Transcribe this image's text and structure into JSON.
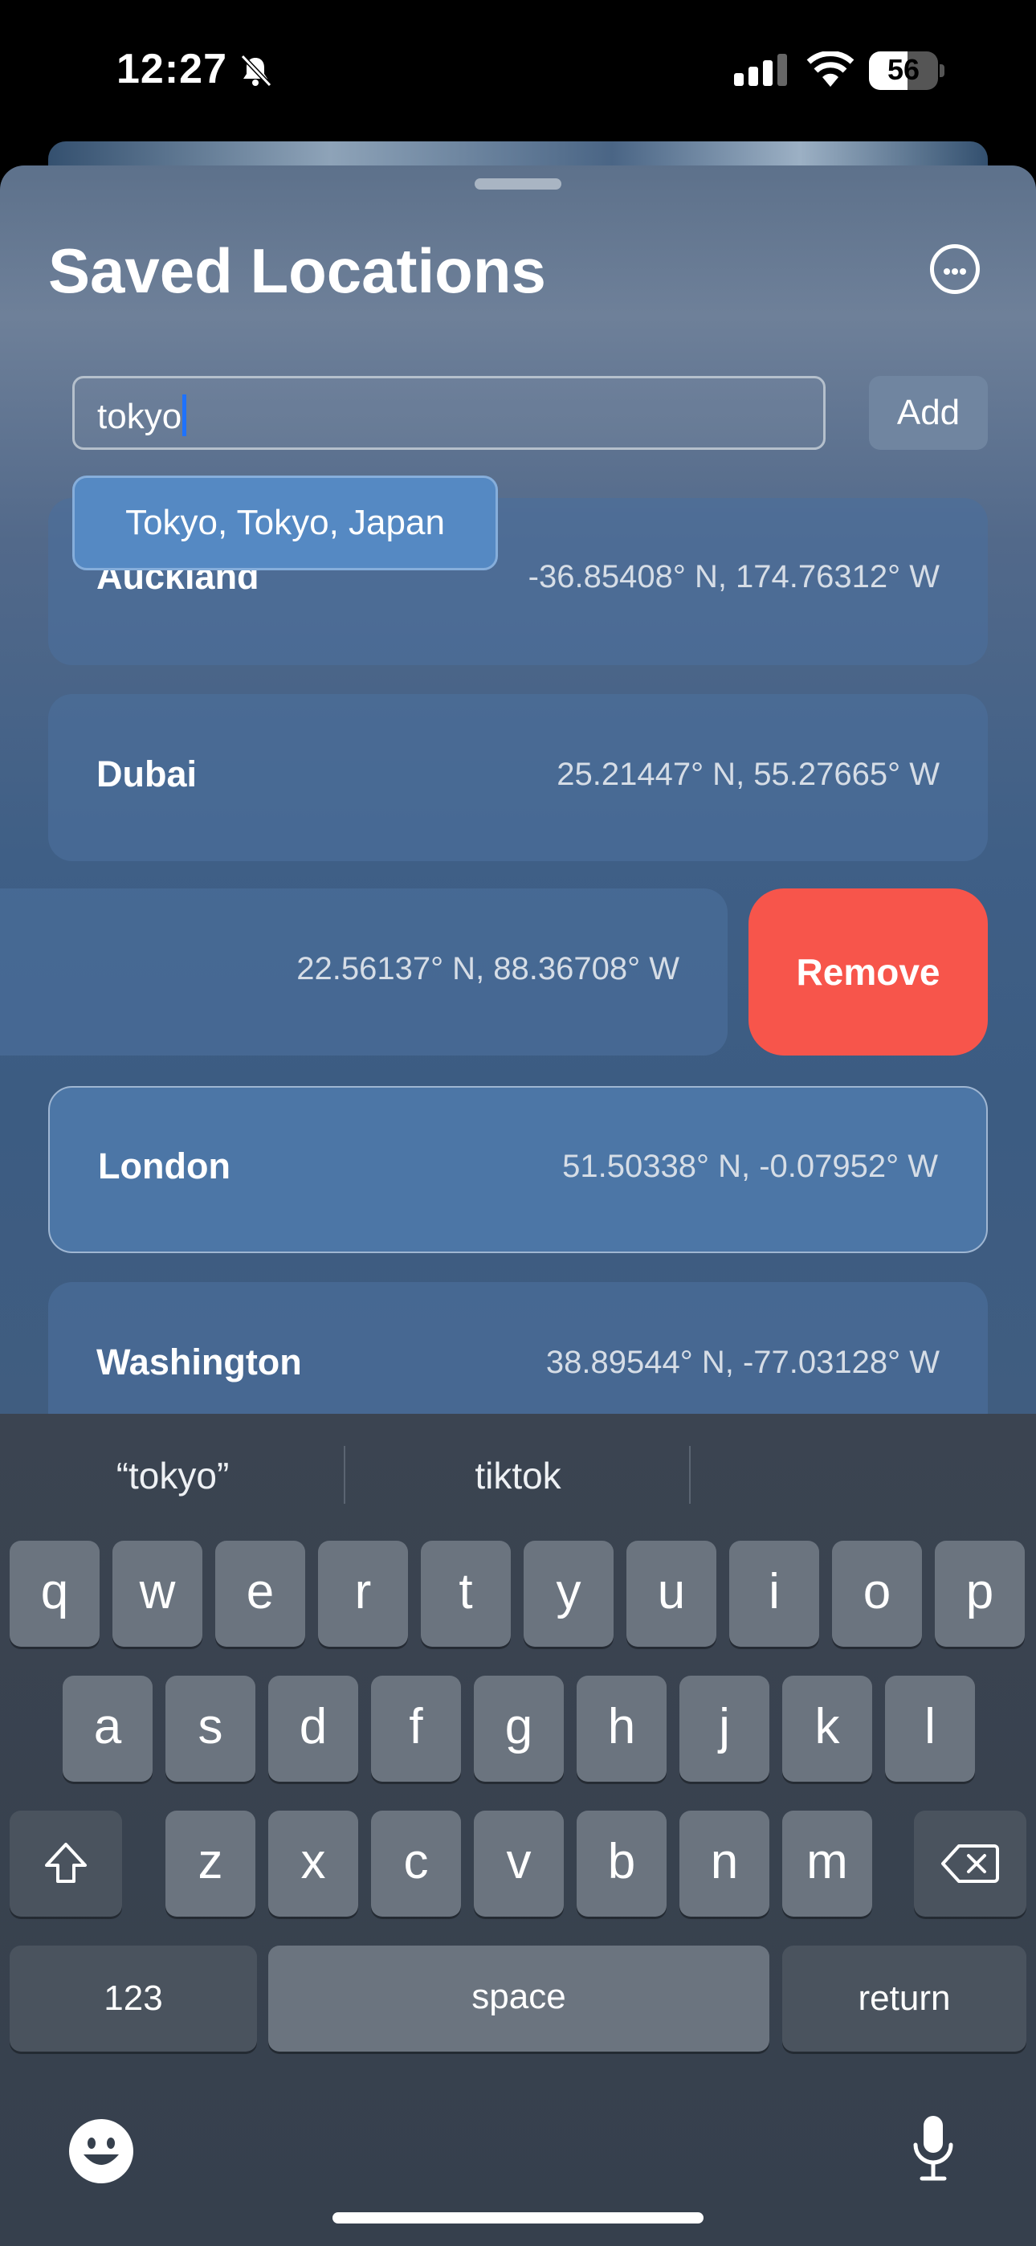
{
  "status_bar": {
    "time": "12:27",
    "battery": "56",
    "battery_level": 0.56
  },
  "sheet": {
    "title": "Saved Locations",
    "more_icon": "ellipsis-circle-icon"
  },
  "search": {
    "value": "tokyo",
    "add_label": "Add"
  },
  "suggestion": {
    "label": "Tokyo, Tokyo, Japan"
  },
  "locations": [
    {
      "name": "Auckland",
      "coords": "-36.85408° N, 174.76312° W"
    },
    {
      "name": "Dubai",
      "coords": "25.21447° N, 55.27665° W"
    },
    {
      "name": "",
      "coords": "22.56137° N, 88.36708° W"
    },
    {
      "name": "London",
      "coords": "51.50338° N, -0.07952° W"
    },
    {
      "name": "Washington",
      "coords": "38.89544° N, -77.03128° W"
    }
  ],
  "swipe_action": {
    "label": "Remove",
    "color": "#f7554b"
  },
  "keyboard": {
    "predictions": [
      "“tokyo”",
      "tiktok",
      ""
    ],
    "row1": [
      "q",
      "w",
      "e",
      "r",
      "t",
      "y",
      "u",
      "i",
      "o",
      "p"
    ],
    "row2": [
      "a",
      "s",
      "d",
      "f",
      "g",
      "h",
      "j",
      "k",
      "l"
    ],
    "row3": [
      "z",
      "x",
      "c",
      "v",
      "b",
      "n",
      "m"
    ],
    "numbers_label": "123",
    "space_label": "space",
    "return_label": "return"
  }
}
